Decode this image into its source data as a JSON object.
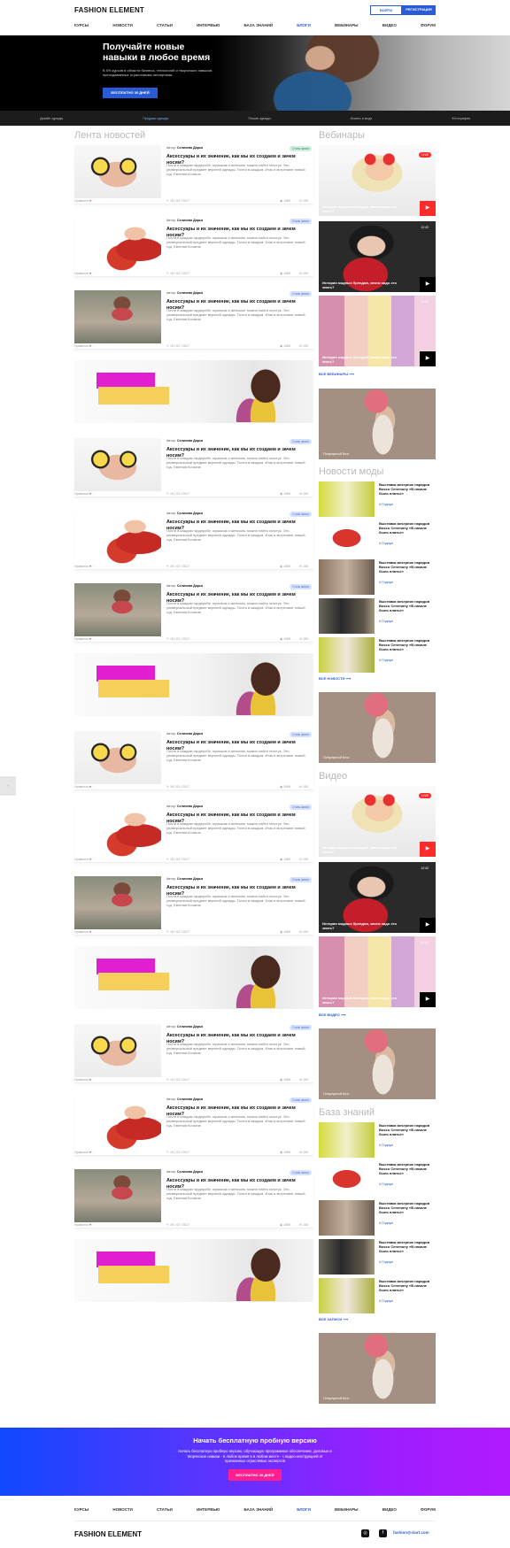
{
  "header": {
    "logo": "FASHION ELEMENT",
    "login": "ВОЙТИ",
    "register": "РЕГИСТРАЦИЯ",
    "nav": [
      "КУРСЫ",
      "НОВОСТИ",
      "СТАТЬИ",
      "ИНТЕРВЬЮ",
      "БАЗА ЗНАНИЙ",
      "БЛОГИ",
      "ВЕБИНАРЫ",
      "ВИДЕО",
      "ФОРУМ"
    ],
    "active_nav": "БЛОГИ"
  },
  "hero": {
    "title_line1": "Получайте новые",
    "title_line2": "навыки в любое время",
    "subtitle_line1": "В 5% курсов в области бизнеса, технологий и творческих навыков,",
    "subtitle_line2": "преподаваемых отраслевыми экспертами.",
    "button": "БЕСПЛАТНО 30 ДНЕЙ",
    "tabs": [
      "Дизайн одежды",
      "Продажи одежды",
      "Пошив одежды",
      "Бизнес в моде",
      "Фотография"
    ],
    "active_tab": "Продажи одежды"
  },
  "feed": {
    "title": "Лента новостей",
    "author_label": "Автор:",
    "author": "Селичева Дарья",
    "card_title": "Аксессуары и их значение, как мы их создаем и зачем носим?",
    "card_text": "Почти в каждом гардеробе, мужском и женском, можно найти галстук. Это универсальный предмет верхней одежды. Почти в каждом. Итак в встречают новый год. Евгения Кочагов",
    "date": "19 / 02 / 2017",
    "views": "1069",
    "comments": "150",
    "likes": "Нравится",
    "cards": [
      {
        "badge": "Стиль жизни",
        "badge_green": true,
        "img": "yellow"
      },
      {
        "badge": "Стиль жизни",
        "badge_green": false,
        "img": "red"
      },
      {
        "badge": "Стиль жизни",
        "badge_green": false,
        "img": "rose"
      },
      {
        "badge": "Стиль жизни",
        "badge_green": false,
        "img": "yellow"
      },
      {
        "badge": "Стиль жизни",
        "badge_green": false,
        "img": "red"
      },
      {
        "badge": "Стиль жизни",
        "badge_green": false,
        "img": "rose"
      },
      {
        "badge": "Стиль жизни",
        "badge_green": false,
        "img": "yellow"
      },
      {
        "badge": "Стиль жизни",
        "badge_green": false,
        "img": "red"
      },
      {
        "badge": "Стиль жизни",
        "badge_green": false,
        "img": "rose"
      },
      {
        "badge": "Стиль жизни",
        "badge_green": false,
        "img": "yellow"
      },
      {
        "badge": "Стиль жизни",
        "badge_green": false,
        "img": "red"
      },
      {
        "badge": "Стиль жизни",
        "badge_green": false,
        "img": "rose"
      }
    ]
  },
  "sidebar": {
    "webinars_title": "Вебинары",
    "video_caption": "История модных брендов, зачем надо это знать?",
    "live": "LIVE",
    "duration": "12:42",
    "all_webinars": "ВСЕ ВЕБИНАРЫ",
    "ad_label": "Популярный Блог",
    "news_title": "Новости моды",
    "news_item_title": "Выставка вечерних нарядов Bosco Ceremony «В начале было платье»",
    "news_tag": "# Подиум",
    "all_news": "ВСЕ НОВОСТИ",
    "video_title": "Видео",
    "all_video": "ВСЕ ВИДЕО",
    "kb_title": "База знаний",
    "all_kb": "ВСЕ ЗАПИСИ"
  },
  "cta": {
    "title": "Начать бесплатную пробную версию",
    "text_line1": "Начать бесплатную пробную версию, обучающую программное обеспечение, деловые и",
    "text_line2": "творческие навыки - в любое время и в любом месте - с видео-инструкцией от",
    "text_line3": "признанных отраслевых экспертов",
    "button": "БЕСПЛАТНО 30 ДНЕЙ"
  },
  "footer": {
    "logo": "FASHION ELEMENT",
    "email": "fashion@start.com",
    "social": [
      "instagram-icon",
      "facebook-icon"
    ]
  },
  "colors": {
    "accent": "#2a5bd7",
    "cta_start": "#1048ff",
    "cta_end": "#b219ff",
    "cta_button": "#ff1f8f",
    "live": "#ff2a2a"
  }
}
